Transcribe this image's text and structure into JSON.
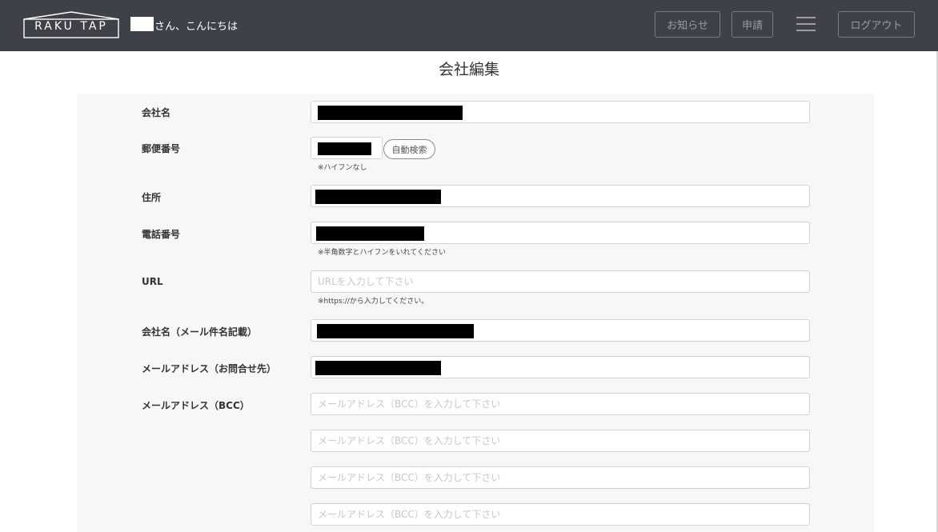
{
  "header": {
    "logo_text": "RAKU TAP",
    "greeting": "さん、こんにちは",
    "notice_label": "お知らせ",
    "apply_label": "申請",
    "logout_label": "ログアウト"
  },
  "page": {
    "title": "会社編集"
  },
  "form": {
    "company_name_label": "会社名",
    "zip_label": "郵便番号",
    "zip_search_label": "自動検索",
    "zip_note": "※ハイフンなし",
    "address_label": "住所",
    "phone_label": "電話番号",
    "phone_note": "※半角数字とハイフンをいれてください",
    "url_label": "URL",
    "url_placeholder": "URLを入力して下さい",
    "url_note": "※https://から入力してください。",
    "mail_subject_label": "会社名（メール件名記載）",
    "contact_email_label": "メールアドレス（お問合せ先）",
    "bcc_label": "メールアドレス（BCC）",
    "bcc_placeholder": "メールアドレス（BCC）を入力して下さい"
  }
}
